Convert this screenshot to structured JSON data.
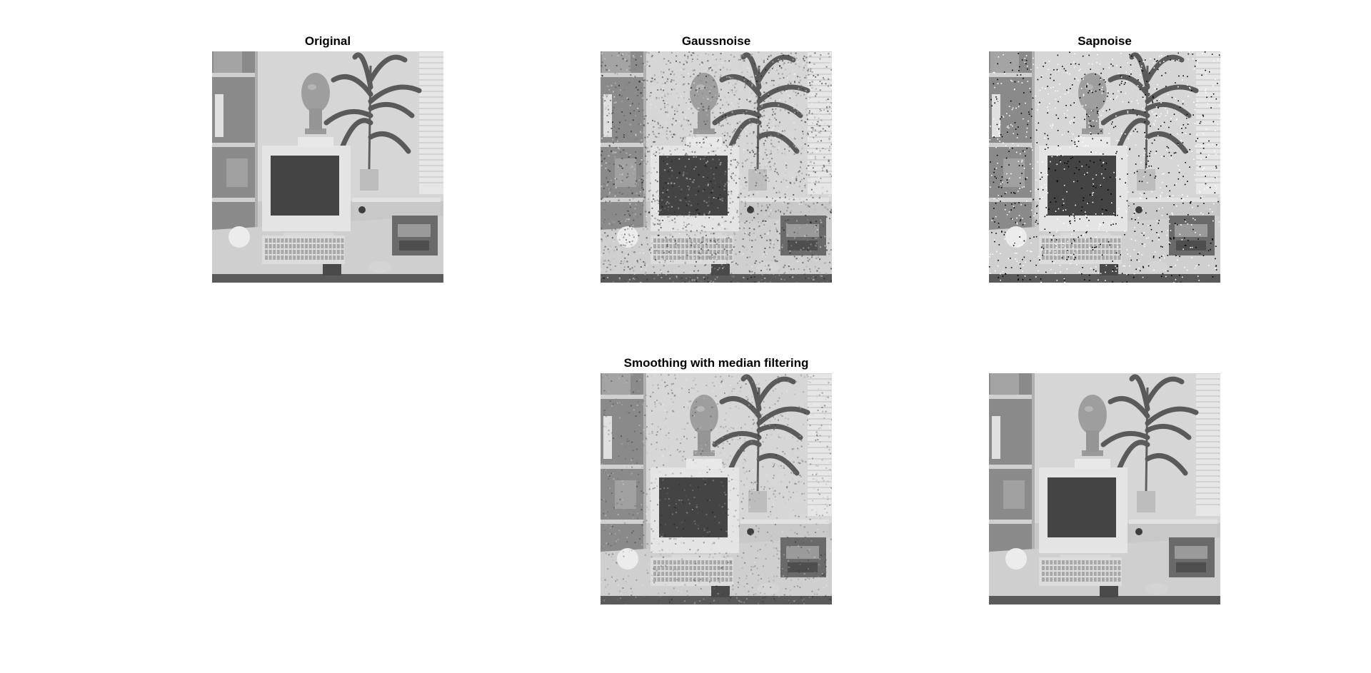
{
  "figure": {
    "titles": {
      "original": "Original",
      "gauss": "Gaussnoise",
      "sap": "Sapnoise",
      "median_gauss": "Smoothing with median filtering",
      "median_sap": ""
    },
    "panels": [
      {
        "key": "original",
        "noise": "none"
      },
      {
        "key": "gauss",
        "noise": "gaussian"
      },
      {
        "key": "sap",
        "noise": "salt-and-pepper"
      },
      {
        "key": "median_gauss",
        "noise": "gaussian-smoothed"
      },
      {
        "key": "median_sap",
        "noise": "median-filtered"
      }
    ]
  }
}
